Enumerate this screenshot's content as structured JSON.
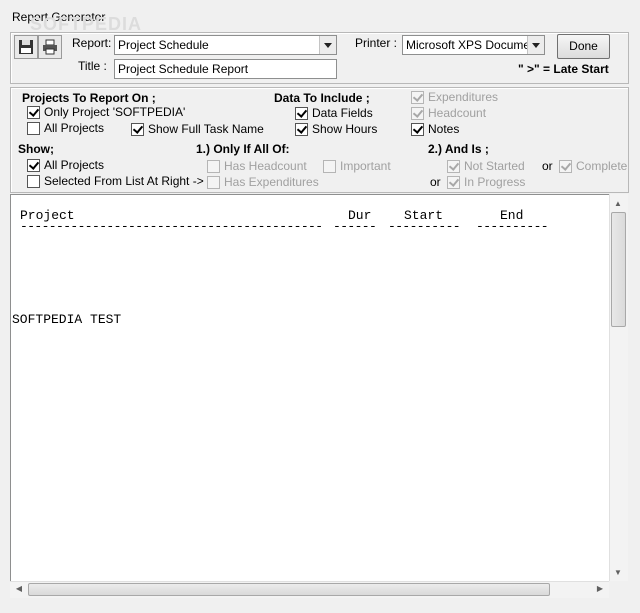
{
  "window": {
    "title": "Report Generator",
    "watermark": "SOFTPEDIA"
  },
  "toolbar": {
    "save_icon": "floppy-disk",
    "print_icon": "printer"
  },
  "report": {
    "label": "Report:",
    "value": "Project Schedule",
    "title_label": "Title :",
    "title_value": "Project Schedule Report"
  },
  "printer": {
    "label": "Printer :",
    "value": "Microsoft XPS Document"
  },
  "done_button": "Done",
  "legend": "\" >\" = Late Start",
  "projects": {
    "header": "Projects To Report On ;",
    "only_project": {
      "label": "Only Project 'SOFTPEDIA'",
      "checked": true
    },
    "all_projects": {
      "label": "All Projects",
      "checked": false
    },
    "show_full_task_name": {
      "label": "Show Full Task Name",
      "checked": true
    }
  },
  "data_include": {
    "header": "Data To Include ;",
    "data_fields": {
      "label": "Data Fields",
      "checked": true
    },
    "show_hours": {
      "label": "Show Hours",
      "checked": true
    },
    "expenditures": {
      "label": "Expenditures",
      "checked": true,
      "disabled": true
    },
    "headcount": {
      "label": "Headcount",
      "checked": true,
      "disabled": true
    },
    "notes": {
      "label": "Notes",
      "checked": true
    }
  },
  "show": {
    "header": "Show;",
    "all_projects": {
      "label": "All Projects",
      "checked": true
    },
    "selected_from_list": {
      "label": "Selected From List At Right ->",
      "checked": false
    }
  },
  "only_if": {
    "header": "1.) Only If All Of:",
    "has_headcount": {
      "label": "Has Headcount",
      "checked": false,
      "disabled": true
    },
    "important": {
      "label": "Important",
      "checked": false,
      "disabled": true
    },
    "has_expenditures": {
      "label": "Has Expenditures",
      "checked": false,
      "disabled": true
    }
  },
  "and_is": {
    "header": "2.) And Is ;",
    "not_started": {
      "label": "Not Started",
      "checked": true,
      "disabled": true
    },
    "or1": "or",
    "complete": {
      "label": "Complete",
      "checked": true,
      "disabled": true
    },
    "or2": "or",
    "in_progress": {
      "label": "In Progress",
      "checked": true,
      "disabled": true
    }
  },
  "output": {
    "col_project": "Project",
    "col_dur": "Dur",
    "col_start": "Start",
    "col_end": "End",
    "underline_project": "------------------------------------------",
    "underline_dur": "------",
    "underline_start": "----------",
    "underline_end": "----------",
    "row1": "SOFTPEDIA TEST"
  },
  "colors": {
    "window_bg": "#f0f0f0",
    "disabled_text": "#a0a0a0"
  }
}
